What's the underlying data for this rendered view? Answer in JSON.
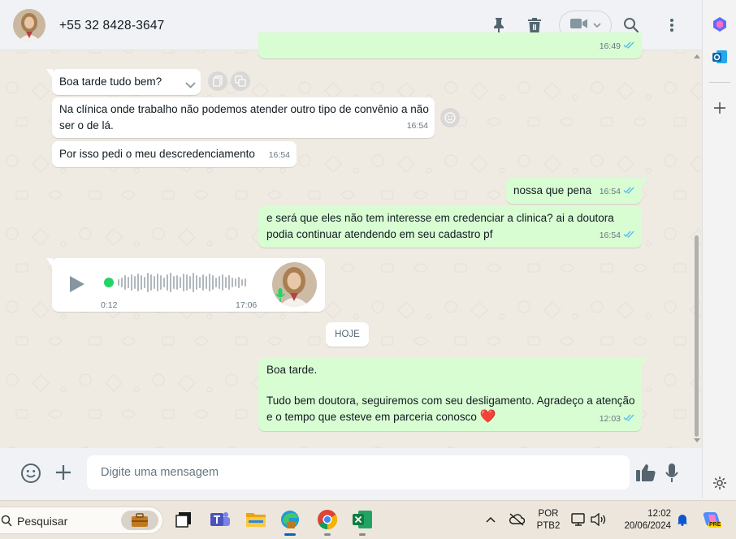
{
  "header": {
    "contact_name": "+55 32 8428-3647",
    "icons": [
      "pin-icon",
      "trash-icon",
      "video-icon",
      "chevron-down-icon",
      "search-icon",
      "more-vertical-icon"
    ]
  },
  "messages": {
    "m0": {
      "time": "16:49"
    },
    "m1": {
      "text": "Boa tarde tudo bem?"
    },
    "m2": {
      "text": "Na clínica onde trabalho não podemos atender outro tipo de convênio a não ser o de lá.",
      "time": "16:54"
    },
    "m3": {
      "text": "Por isso pedi o meu descredenciamento",
      "time": "16:54"
    },
    "m4": {
      "text": "nossa que pena",
      "time": "16:54"
    },
    "m5": {
      "text": "e será que eles não tem interesse em credenciar a clinica? ai a doutora podia continuar atendendo em seu cadastro pf",
      "time": "16:54"
    },
    "voice": {
      "duration": "0:12",
      "time": "17:06"
    },
    "date_chip": "HOJE",
    "m6": {
      "line1": "Boa tarde.",
      "line2": "Tudo bem doutora, seguiremos com seu desligamento. Agradeço a atenção e o tempo que esteve em parceria conosco",
      "emoji": "❤️",
      "time": "12:03"
    }
  },
  "footer": {
    "placeholder": "Digite uma mensagem",
    "icons": [
      "emoji-icon",
      "plus-icon",
      "thumbs-up-icon",
      "mic-icon"
    ]
  },
  "taskbar": {
    "search_label": "Pesquisar",
    "lang_line1": "POR",
    "lang_line2": "PTB2",
    "time": "12:02",
    "date": "20/06/2024",
    "copilot_badge": "PRE"
  },
  "colors": {
    "incoming_bubble": "#ffffff",
    "outgoing_bubble": "#d9fdd3",
    "read_ticks": "#53bdeb",
    "voice_dot": "#25d366",
    "chat_bg": "#efeae2"
  }
}
